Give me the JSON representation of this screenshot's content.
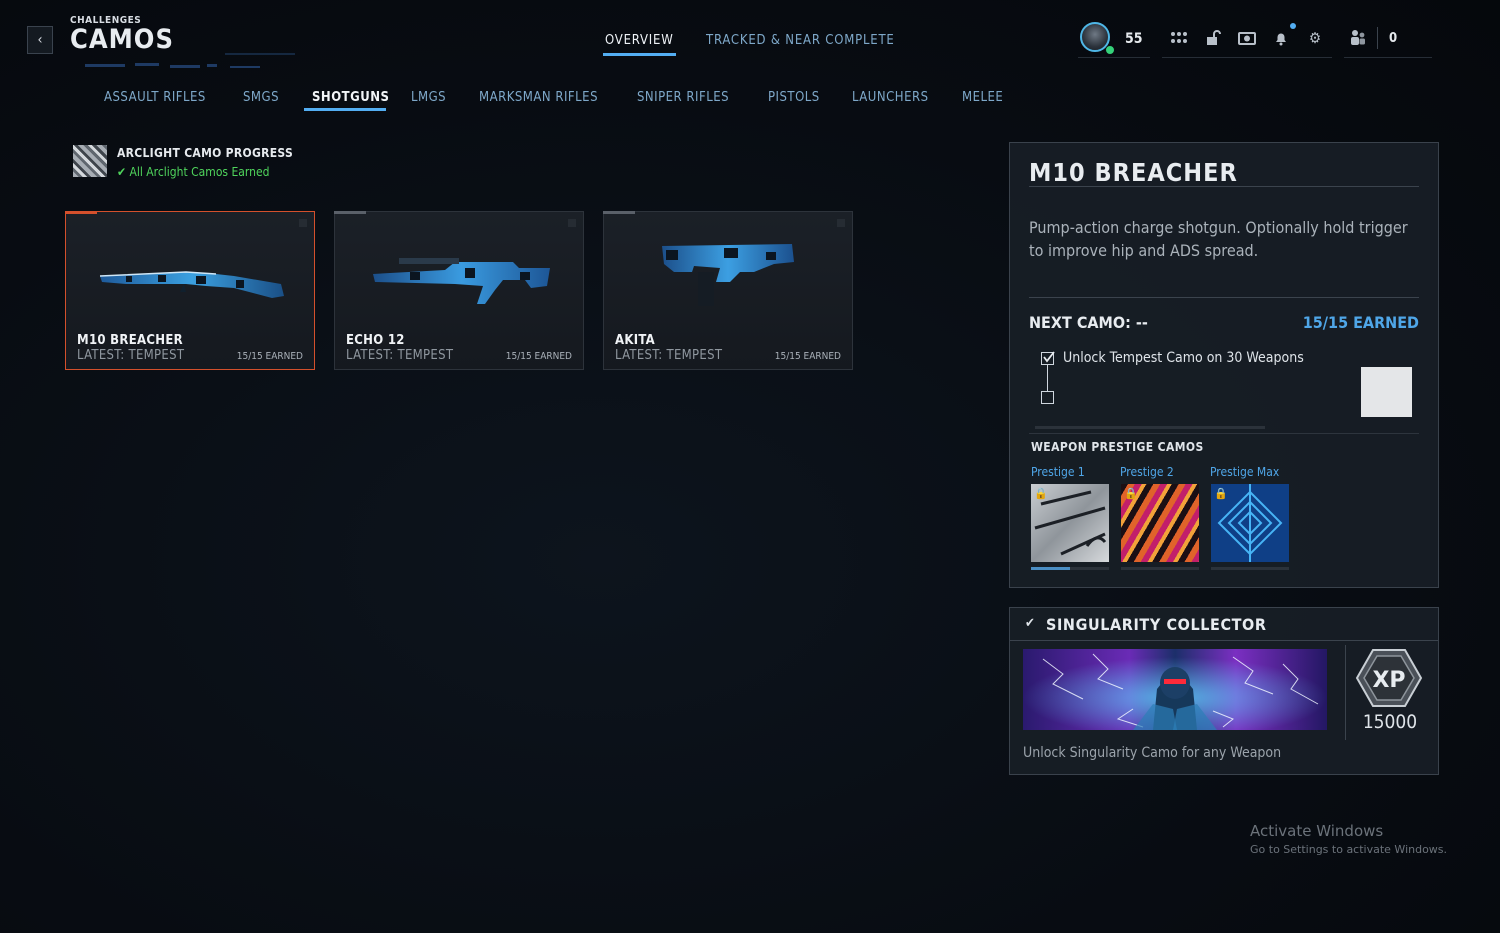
{
  "header": {
    "back_icon": "chevron-left-icon",
    "breadcrumb": "CHALLENGES",
    "title": "CAMOS",
    "tabs": [
      {
        "label": "OVERVIEW",
        "active": true
      },
      {
        "label": "TRACKED & NEAR COMPLETE",
        "active": false
      }
    ],
    "player_level": "55",
    "icons": [
      "grid-icon",
      "unlock-icon",
      "camera-icon",
      "bell-icon",
      "gear-icon",
      "social-icon"
    ],
    "currency": "0"
  },
  "categories": [
    {
      "label": "ASSAULT RIFLES",
      "active": false
    },
    {
      "label": "SMGS",
      "active": false
    },
    {
      "label": "SHOTGUNS",
      "active": true
    },
    {
      "label": "LMGS",
      "active": false
    },
    {
      "label": "MARKSMAN RIFLES",
      "active": false
    },
    {
      "label": "SNIPER RIFLES",
      "active": false
    },
    {
      "label": "PISTOLS",
      "active": false
    },
    {
      "label": "LAUNCHERS",
      "active": false
    },
    {
      "label": "MELEE",
      "active": false
    }
  ],
  "arclight": {
    "title": "ARCLIGHT CAMO PROGRESS",
    "status": "All Arclight Camos Earned",
    "status_color": "#4fd45c"
  },
  "weapons": [
    {
      "name": "M10 BREACHER",
      "latest": "LATEST: TEMPEST",
      "earned": "15/15 EARNED",
      "selected": true
    },
    {
      "name": "ECHO 12",
      "latest": "LATEST: TEMPEST",
      "earned": "15/15 EARNED",
      "selected": false
    },
    {
      "name": "AKITA",
      "latest": "LATEST: TEMPEST",
      "earned": "15/15 EARNED",
      "selected": false
    }
  ],
  "detail": {
    "title": "M10 BREACHER",
    "description": "Pump-action charge shotgun. Optionally hold trigger to improve hip and ADS spread.",
    "next_camo_label": "NEXT CAMO: --",
    "earned": "15/15 EARNED",
    "task": "Unlock Tempest Camo on 30 Weapons",
    "prestige_heading": "WEAPON PRESTIGE CAMOS",
    "prestige": [
      {
        "label": "Prestige 1",
        "progress": 0.5
      },
      {
        "label": "Prestige 2",
        "progress": 0
      },
      {
        "label": "Prestige Max",
        "progress": 0
      }
    ]
  },
  "singularity": {
    "title": "SINGULARITY COLLECTOR",
    "xp_badge": "XP",
    "xp": "15000",
    "description": "Unlock Singularity Camo for any Weapon"
  },
  "watermark": {
    "title": "Activate Windows",
    "subtitle": "Go to Settings to activate Windows."
  },
  "accent_color": "#53aef2",
  "selection_color": "#d4502c"
}
